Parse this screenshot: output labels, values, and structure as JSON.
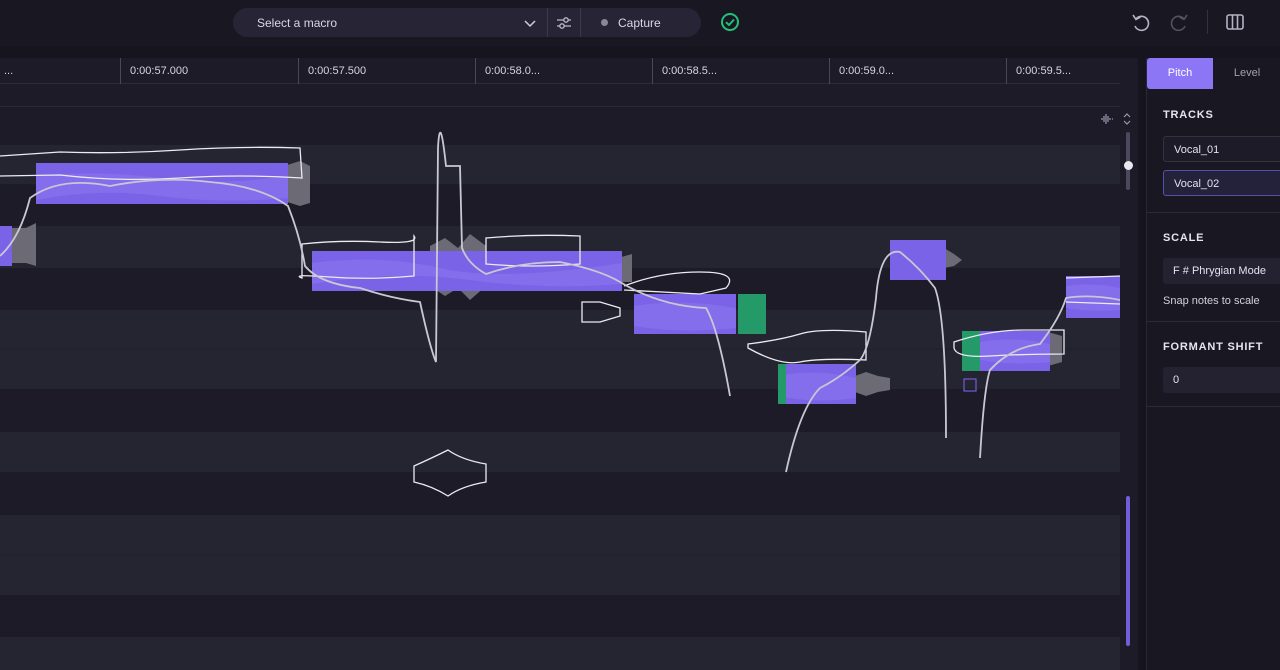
{
  "toolbar": {
    "macro_placeholder": "Select a macro",
    "capture_label": "Capture",
    "icons": [
      "chevron-down-icon",
      "sliders-icon",
      "record-dot-icon",
      "check-circle-icon",
      "undo-icon",
      "redo-icon",
      "layout-columns-icon"
    ],
    "status_color": "#23c07a"
  },
  "ruler": {
    "ticks": [
      "...",
      "0:00:57.000",
      "0:00:57.500",
      "0:00:58.0...",
      "0:00:58.5...",
      "0:00:59.0...",
      "0:00:59.5..."
    ]
  },
  "colors": {
    "note_purple": "#7a63e6",
    "note_green": "#239a68",
    "accent": "#8d76f6"
  },
  "panel": {
    "tabs": [
      {
        "label": "Pitch",
        "active": true
      },
      {
        "label": "Level",
        "active": false
      }
    ],
    "tracks_title": "TRACKS",
    "tracks": [
      {
        "name": "Vocal_01",
        "selected": false
      },
      {
        "name": "Vocal_02",
        "selected": true
      }
    ],
    "scale_title": "SCALE",
    "scale_value": "F # Phrygian Mode",
    "snap_label": "Snap notes to scale",
    "formant_title": "FORMANT SHIFT",
    "formant_value": "0"
  }
}
